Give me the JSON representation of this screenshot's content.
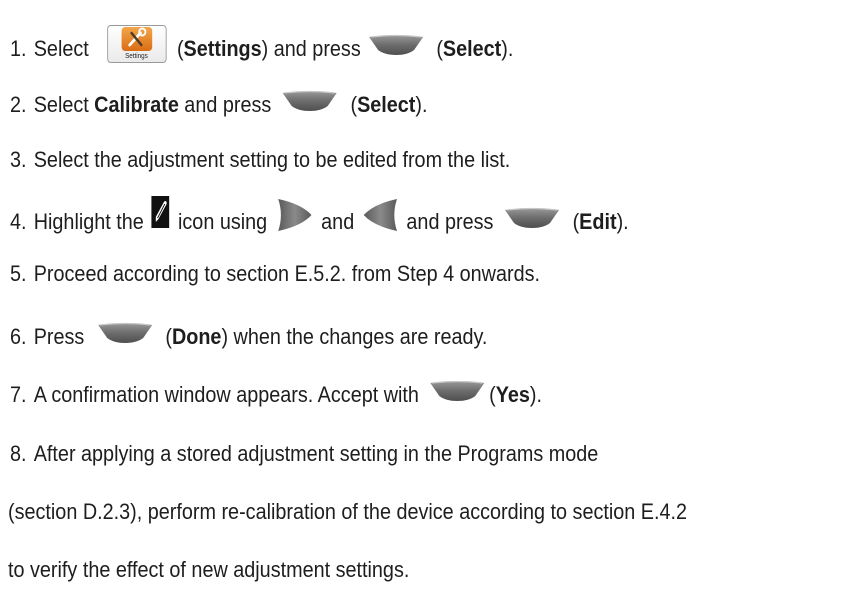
{
  "steps": [
    {
      "number": "1.",
      "parts": {
        "a": "Select",
        "settings_open": "(",
        "settings_bold": "Settings",
        "settings_close": ") and press",
        "select_open": "(",
        "select_bold": "Select",
        "select_close": ")."
      },
      "icons": [
        "settings-app-icon",
        "softkey-button-icon"
      ]
    },
    {
      "number": "2.",
      "parts": {
        "a": "Select",
        "calibrate_bold": "Calibrate",
        "b": "and press",
        "select_open": "(",
        "select_bold": "Select",
        "select_close": ")."
      },
      "icons": [
        "softkey-button-icon"
      ]
    },
    {
      "number": "3.",
      "text": "Select the adjustment setting to be edited from the list."
    },
    {
      "number": "4.",
      "parts": {
        "a": "Highlight the",
        "b": "icon using",
        "c": "and",
        "d": "and press",
        "edit_open": "(",
        "edit_bold": "Edit",
        "edit_close": ")."
      },
      "icons": [
        "edit-pencil-icon",
        "right-arrow-button-icon",
        "left-arrow-button-icon",
        "softkey-button-icon"
      ]
    },
    {
      "number": "5.",
      "text": "Proceed according to section E.5.2. from Step 4 onwards."
    },
    {
      "number": "6.",
      "parts": {
        "a": "Press",
        "done_open": "(",
        "done_bold": "Done",
        "done_close": ") when the changes are ready."
      },
      "icons": [
        "softkey-button-icon"
      ]
    },
    {
      "number": "7.",
      "parts": {
        "a": "A confirmation window appears. Accept with",
        "yes_open": "(",
        "yes_bold": "Yes",
        "yes_close": ")."
      },
      "icons": [
        "softkey-button-icon"
      ]
    },
    {
      "number": "8.",
      "lines": [
        "After applying a stored adjustment setting in the Programs mode",
        "(section D.2.3), perform re-calibration of the device according to section E.4.2",
        "to verify the effect of new adjustment settings."
      ]
    }
  ],
  "settings_icon_label": "Settings",
  "colors": {
    "text": "#1e1e1e",
    "button_gray": "#6f6f6f",
    "settings_orange": "#e07a1c"
  }
}
